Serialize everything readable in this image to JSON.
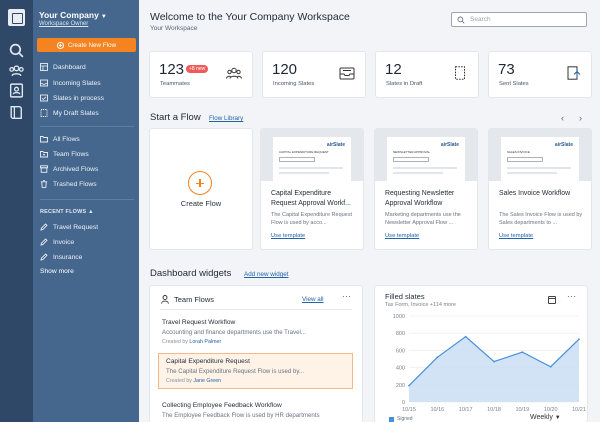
{
  "rail": {
    "icons": [
      "app-logo-icon",
      "search-icon",
      "team-icon",
      "contacts-icon",
      "book-icon"
    ]
  },
  "sidebar": {
    "company": "Your Company",
    "role": "Workspace Owner",
    "create_flow": "Create New Flow",
    "items": [
      {
        "label": "Dashboard",
        "icon": "dashboard-icon"
      },
      {
        "label": "Incoming Slates",
        "icon": "inbox-icon",
        "has_dot": true
      },
      {
        "label": "Slates in process",
        "icon": "process-icon"
      },
      {
        "label": "My Draft Slates",
        "icon": "draft-icon"
      }
    ],
    "flows": [
      {
        "label": "All Flows",
        "icon": "folder-icon"
      },
      {
        "label": "Team Flows",
        "icon": "team-folder-icon"
      },
      {
        "label": "Archived Flows",
        "icon": "archive-icon"
      },
      {
        "label": "Trashed Flows",
        "icon": "trash-icon"
      }
    ],
    "recent_label": "RECENT FLOWS",
    "recent": [
      {
        "label": "Travel Request",
        "icon": "pencil-icon"
      },
      {
        "label": "Invoice",
        "icon": "pencil-icon"
      },
      {
        "label": "Insurance",
        "icon": "pencil-icon"
      }
    ],
    "show_more": "Show more"
  },
  "header": {
    "title": "Welcome to the Your Company Workspace",
    "subtitle": "Your Workspace",
    "search_placeholder": "Search"
  },
  "stats": [
    {
      "value": "123",
      "label": "Teammates",
      "badge": "+8 new",
      "icon": "people-icon"
    },
    {
      "value": "120",
      "label": "Incoming Slates",
      "icon": "inbox-tray-icon"
    },
    {
      "value": "12",
      "label": "Slates in Draft",
      "icon": "draft-doc-icon"
    },
    {
      "value": "73",
      "label": "Sent Slates",
      "icon": "sent-doc-icon"
    }
  ],
  "start_flow": {
    "title": "Start a Flow",
    "library_link": "Flow Library",
    "create_label": "Create Flow",
    "templates": [
      {
        "title": "Capital Expenditure Request Approval Workf...",
        "desc": "The Capital Expenditure Request Flow is used by acco...",
        "action": "Use template",
        "doc_title": "CAPITAL EXPENDITURE REQUEST",
        "brand": "airSlate"
      },
      {
        "title": "Requesting Newsletter Approval Workflow",
        "desc": "Marketing departments use the Newsletter Approval Flow ...",
        "action": "Use template",
        "doc_title": "NEWSLETTER APPROVAL",
        "brand": "airSlate"
      },
      {
        "title": "Sales Invoice Workflow",
        "desc": "The Sales Invoice Flow is used by Sales departments to ...",
        "action": "Use template",
        "doc_title": "SALES INVOICE",
        "brand": "airSlate"
      }
    ]
  },
  "widgets": {
    "title": "Dashboard widgets",
    "add_link": "Add new widget",
    "team_flows": {
      "title": "Team Flows",
      "view_all": "View all",
      "items": [
        {
          "name": "Travel Request Workflow",
          "desc": "Accounting and finance departments use the Travel...",
          "created_prefix": "Created by",
          "creator": "Lorah Palmer",
          "selected": false
        },
        {
          "name": "Capital Expenditure Request",
          "desc": "The Capital Expenditure Request Flow is used by...",
          "created_prefix": "Created by",
          "creator": "Jane Green",
          "selected": true
        },
        {
          "name": "Collecting Employee Feedback Workflow",
          "desc": "The Employee Feedback Flow is used by HR departments",
          "created_prefix": "",
          "creator": "",
          "selected": false
        }
      ]
    },
    "filled_slates": {
      "title": "Filled slates",
      "subtitle": "Tax Form, Invoice +114 more",
      "period": "Weekly",
      "legend": "Signed"
    }
  },
  "chart_data": {
    "type": "area",
    "x": [
      "10/15",
      "10/16",
      "10/17",
      "10/18",
      "10/19",
      "10/20",
      "10/21"
    ],
    "series": [
      {
        "name": "Signed",
        "values": [
          190,
          520,
          760,
          470,
          580,
          410,
          730
        ]
      }
    ],
    "ylim": [
      0,
      1000
    ],
    "yticks": [
      0,
      200,
      400,
      600,
      800,
      1000
    ],
    "grid": true,
    "color": "#4a90d9",
    "fill": "#c9def3"
  },
  "colors": {
    "accent": "#f5831f",
    "sidebar": "#45678e",
    "rail": "#2f4868",
    "link": "#2563a8",
    "badge": "#ef5a5a"
  }
}
